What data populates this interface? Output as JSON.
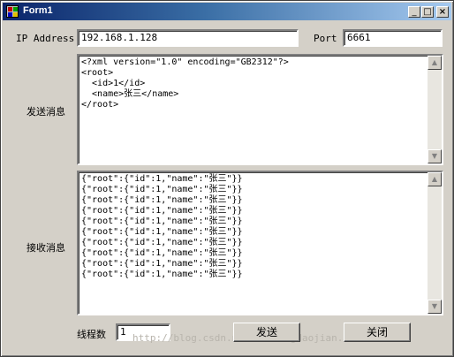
{
  "window": {
    "title": "Form1",
    "minimize": "_",
    "maximize": "□",
    "close": "×"
  },
  "form": {
    "ip_label": "IP Address",
    "ip_value": "192.168.1.128",
    "port_label": "Port",
    "port_value": "6661",
    "send_label": "发送消息",
    "send_text": "<?xml version=\"1.0\" encoding=\"GB2312\"?>\n<root>\n  <id>1</id>\n  <name>张三</name>\n</root>",
    "recv_label": "接收消息",
    "recv_text": "{\"root\":{\"id\":1,\"name\":\"张三\"}}\n{\"root\":{\"id\":1,\"name\":\"张三\"}}\n{\"root\":{\"id\":1,\"name\":\"张三\"}}\n{\"root\":{\"id\":1,\"name\":\"张三\"}}\n{\"root\":{\"id\":1,\"name\":\"张三\"}}\n{\"root\":{\"id\":1,\"name\":\"张三\"}}\n{\"root\":{\"id\":1,\"name\":\"张三\"}}\n{\"root\":{\"id\":1,\"name\":\"张三\"}}\n{\"root\":{\"id\":1,\"name\":\"张三\"}}\n{\"root\":{\"id\":1,\"name\":\"张三\"}}",
    "threads_label": "线程数",
    "threads_value": "1",
    "send_button": "发送",
    "close_button": "关闭"
  },
  "watermark": "http://blog.csdn.net/luotengdaojian.com",
  "scroll_up": "▲",
  "scroll_down": "▼"
}
